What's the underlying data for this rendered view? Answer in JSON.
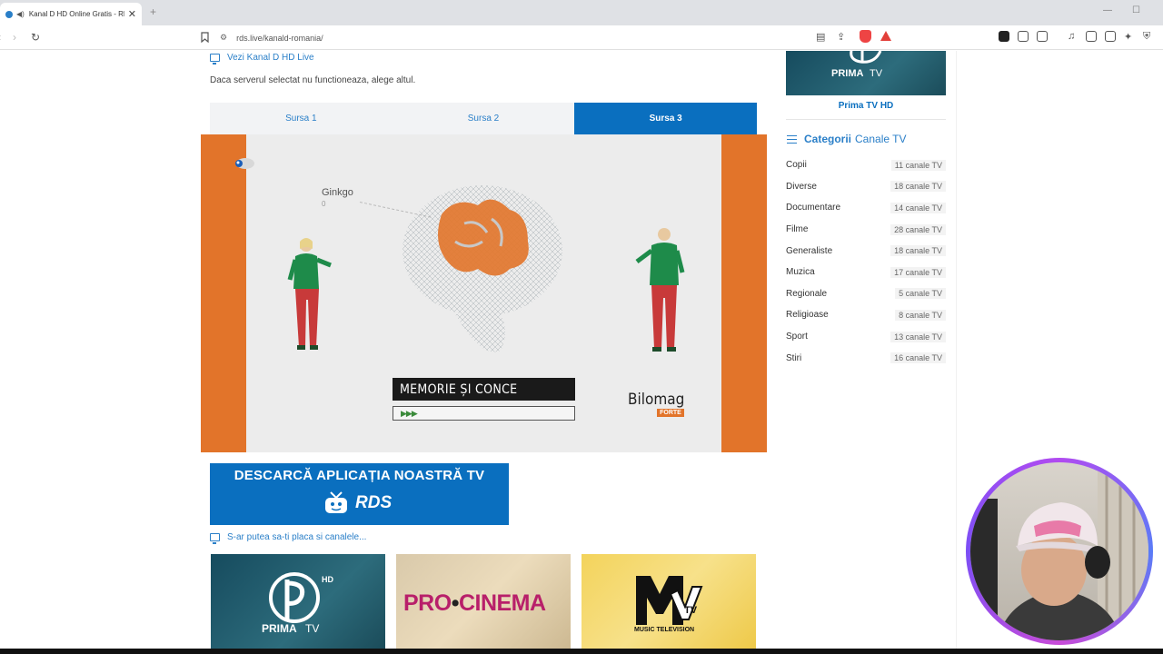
{
  "browser": {
    "tab_title": "Kanal D HD Online Gratis - RD",
    "url": "rds.live/kanald-romania/",
    "new_tab": "+",
    "close_glyph": "✕"
  },
  "player_section": {
    "heading": "Vezi Kanal D HD Live",
    "notice": "Daca serverul selectat nu functioneaza, alege altul.",
    "sources": [
      "Sursa 1",
      "Sursa 2",
      "Sursa 3"
    ],
    "active_source": 2
  },
  "video": {
    "ginkgo_label": "Ginkgo",
    "ginkgo_value": "0",
    "banner_title": "MEMORIE ȘI CONCE",
    "banner_sub": "▶▶▶",
    "brand": "Bilomag",
    "brand_badge": "FORTE",
    "side_color": "#e2742a"
  },
  "app_banner": {
    "line1": "DESCARCĂ APLICAȚIA NOASTRĂ TV",
    "brand": "RDS"
  },
  "related": {
    "heading": "S-ar putea sa-ti placa si canalele...",
    "pro_cinema": "PRO",
    "pro_cinema_2": "CINEMA",
    "mtv_sub": "MUSIC TELEVISION"
  },
  "sidebar": {
    "top_channel": "Prima TV HD",
    "categories_heading_bold": "Categorii",
    "categories_heading_rest": "Canale TV",
    "categories": [
      {
        "name": "Copii",
        "count": "11 canale TV"
      },
      {
        "name": "Diverse",
        "count": "18 canale TV"
      },
      {
        "name": "Documentare",
        "count": "14 canale TV"
      },
      {
        "name": "Filme",
        "count": "28 canale TV"
      },
      {
        "name": "Generaliste",
        "count": "18 canale TV"
      },
      {
        "name": "Muzica",
        "count": "17 canale TV"
      },
      {
        "name": "Regionale",
        "count": "5 canale TV"
      },
      {
        "name": "Religioase",
        "count": "8 canale TV"
      },
      {
        "name": "Sport",
        "count": "13 canale TV"
      },
      {
        "name": "Stiri",
        "count": "16 canale TV"
      }
    ]
  },
  "colors": {
    "accent": "#2a7fc8",
    "active_tab": "#0a6fbf",
    "orange": "#e2742a"
  }
}
